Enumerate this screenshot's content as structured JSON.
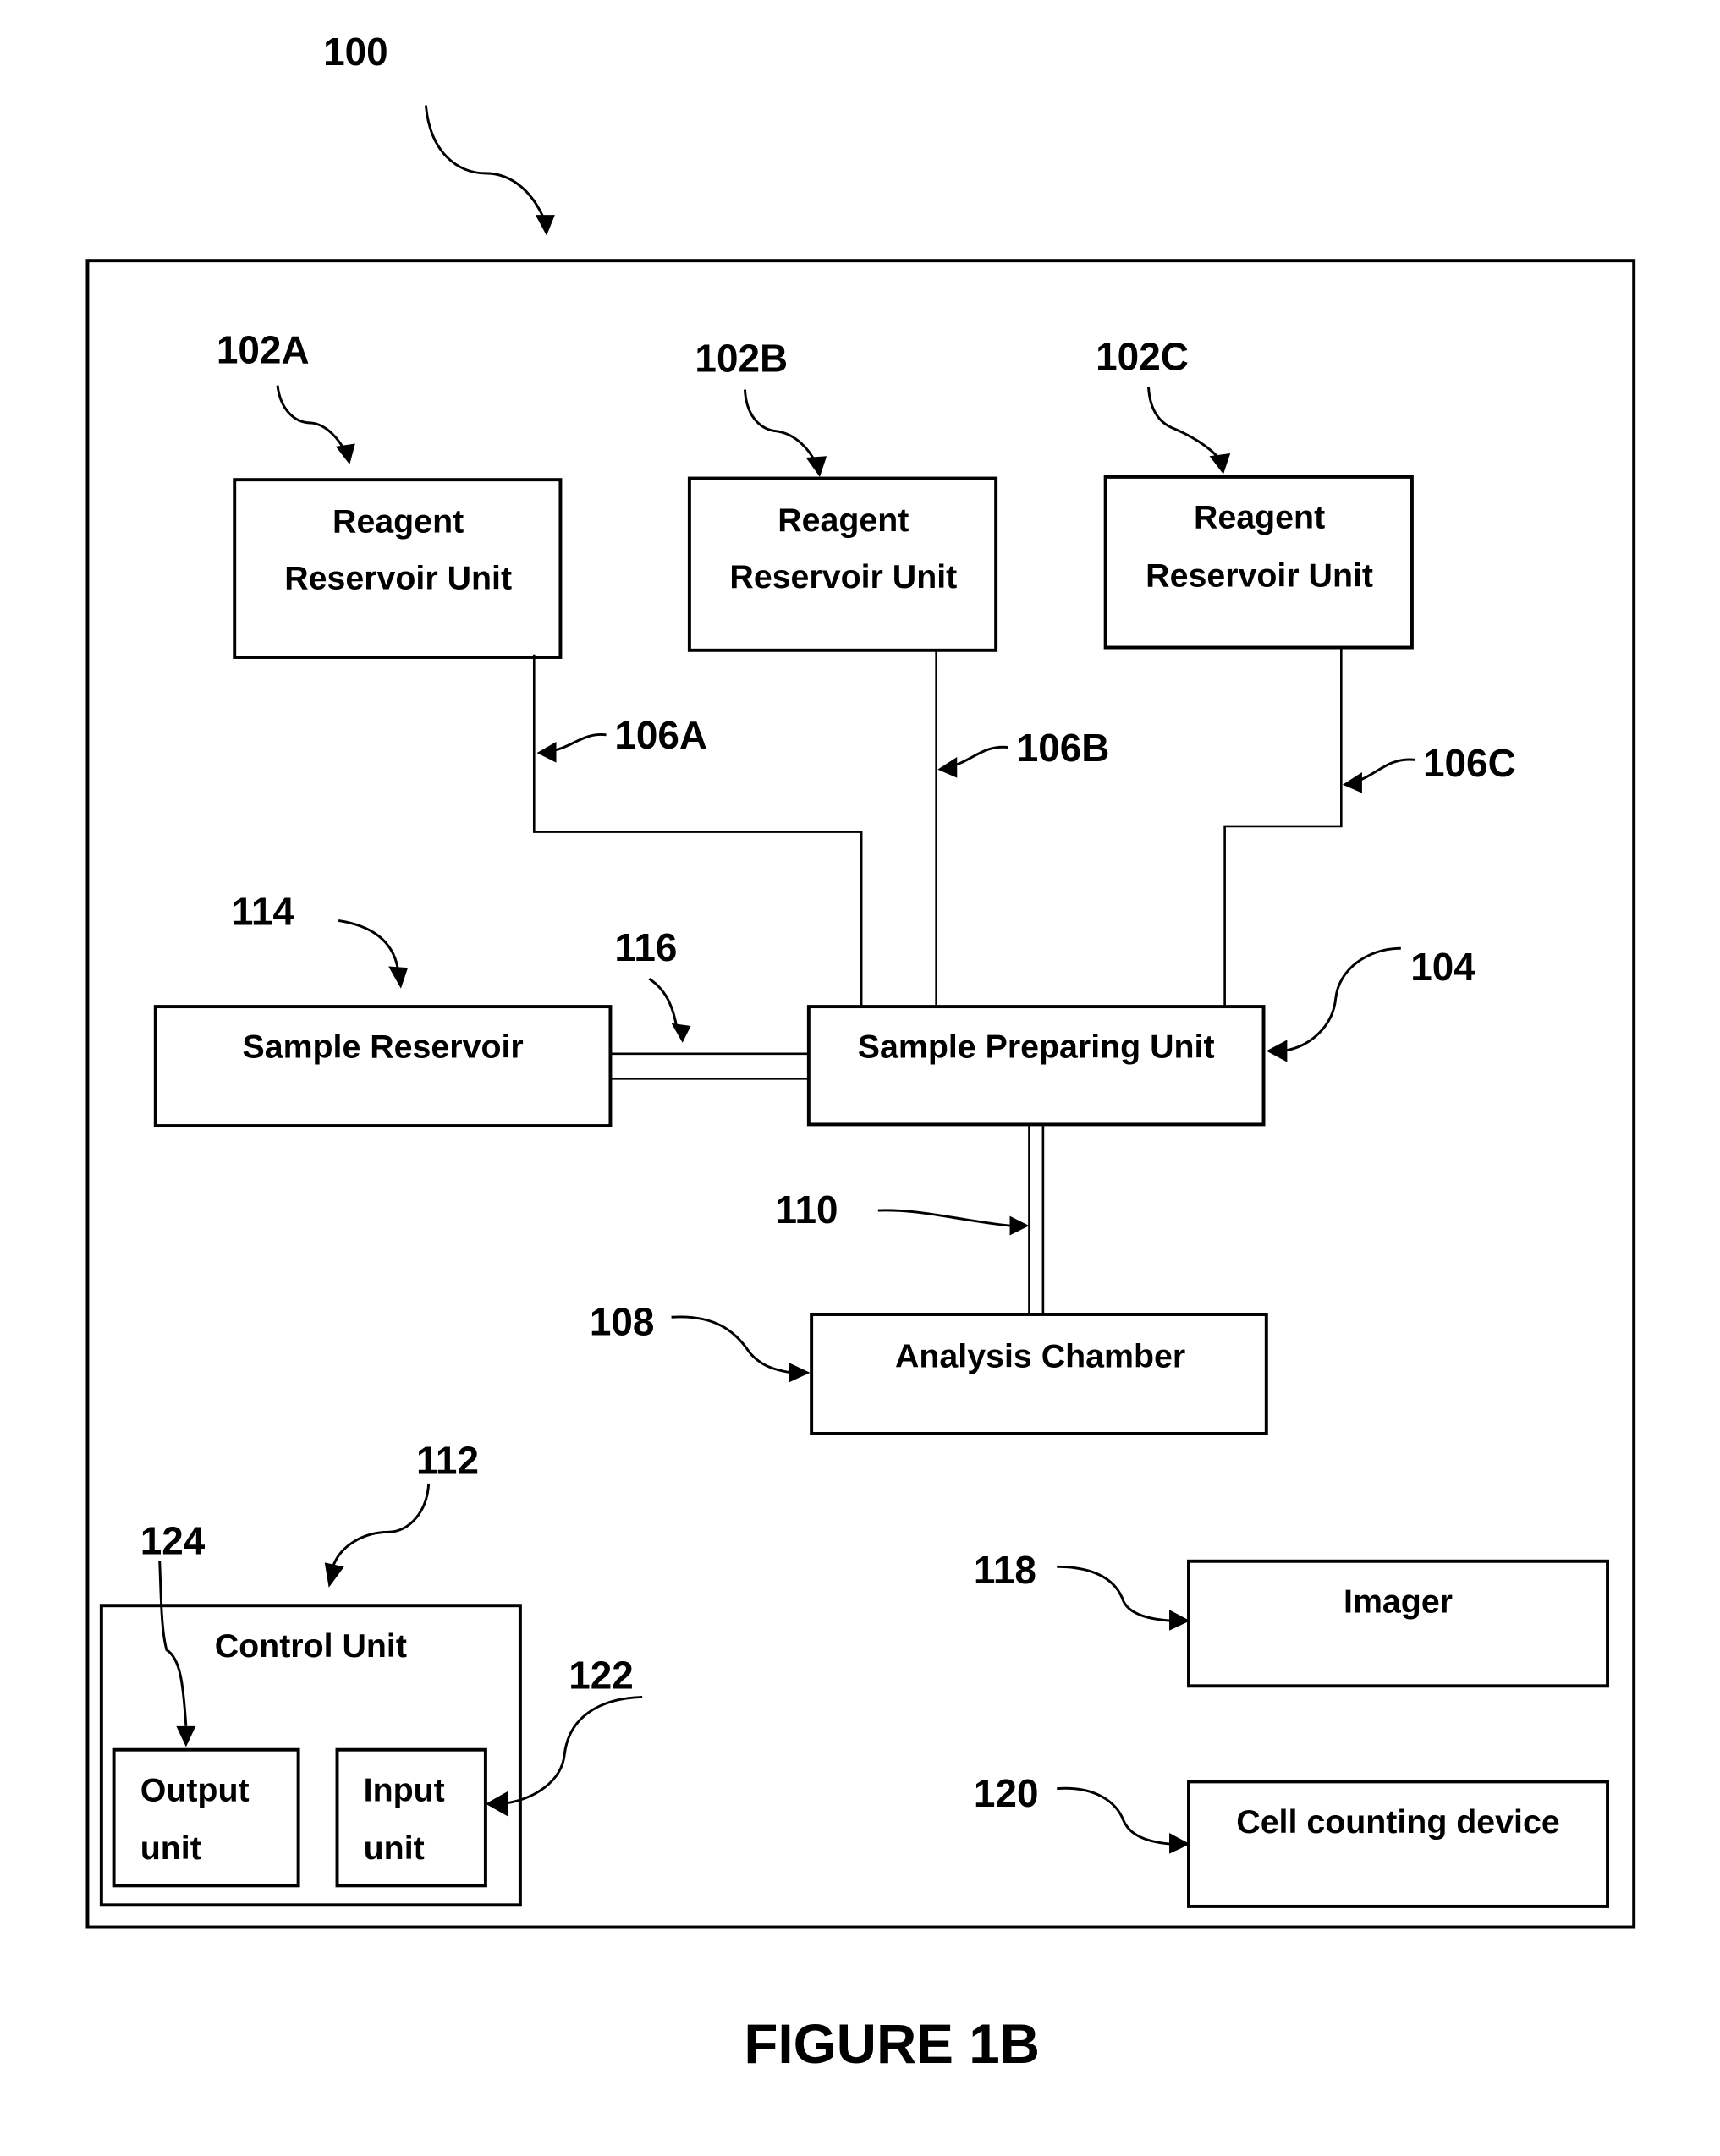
{
  "figure": {
    "caption": "FIGURE 1B",
    "system_ref": "100"
  },
  "components": {
    "reagent_a": {
      "ref": "102A",
      "line1": "Reagent",
      "line2": "Reservoir Unit"
    },
    "reagent_b": {
      "ref": "102B",
      "line1": "Reagent",
      "line2": "Reservoir Unit"
    },
    "reagent_c": {
      "ref": "102C",
      "line1": "Reagent",
      "line2": "Reservoir Unit"
    },
    "sample_reservoir": {
      "ref": "114",
      "label": "Sample Reservoir"
    },
    "sample_preparing_unit": {
      "ref": "104",
      "label": "Sample Preparing Unit"
    },
    "analysis_chamber": {
      "ref": "108",
      "label": "Analysis Chamber"
    },
    "control_unit": {
      "ref": "112",
      "label": "Control Unit"
    },
    "output_unit": {
      "ref": "124",
      "line1": "Output",
      "line2": "unit"
    },
    "input_unit": {
      "ref": "122",
      "line1": "Input",
      "line2": "unit"
    },
    "imager": {
      "ref": "118",
      "label": "Imager"
    },
    "cell_counting_device": {
      "ref": "120",
      "label": "Cell counting device"
    }
  },
  "connections": {
    "channel_a": {
      "ref": "106A"
    },
    "channel_b": {
      "ref": "106B"
    },
    "channel_c": {
      "ref": "106C"
    },
    "sample_channel": {
      "ref": "116"
    },
    "analysis_channel": {
      "ref": "110"
    }
  }
}
